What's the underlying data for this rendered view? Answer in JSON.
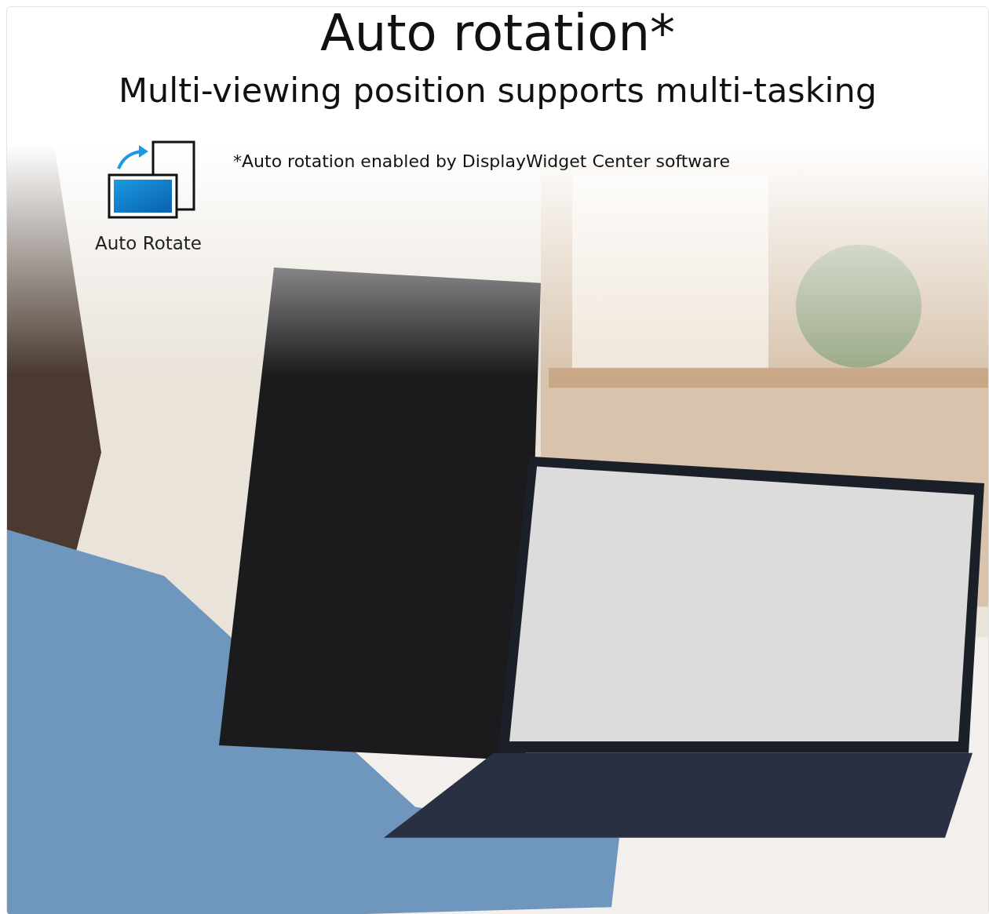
{
  "heading": "Auto rotation*",
  "subheading": "Multi-viewing position supports multi-tasking",
  "feature": {
    "label": "Auto Rotate"
  },
  "footnote": "*Auto rotation enabled by DisplayWidget Center software"
}
